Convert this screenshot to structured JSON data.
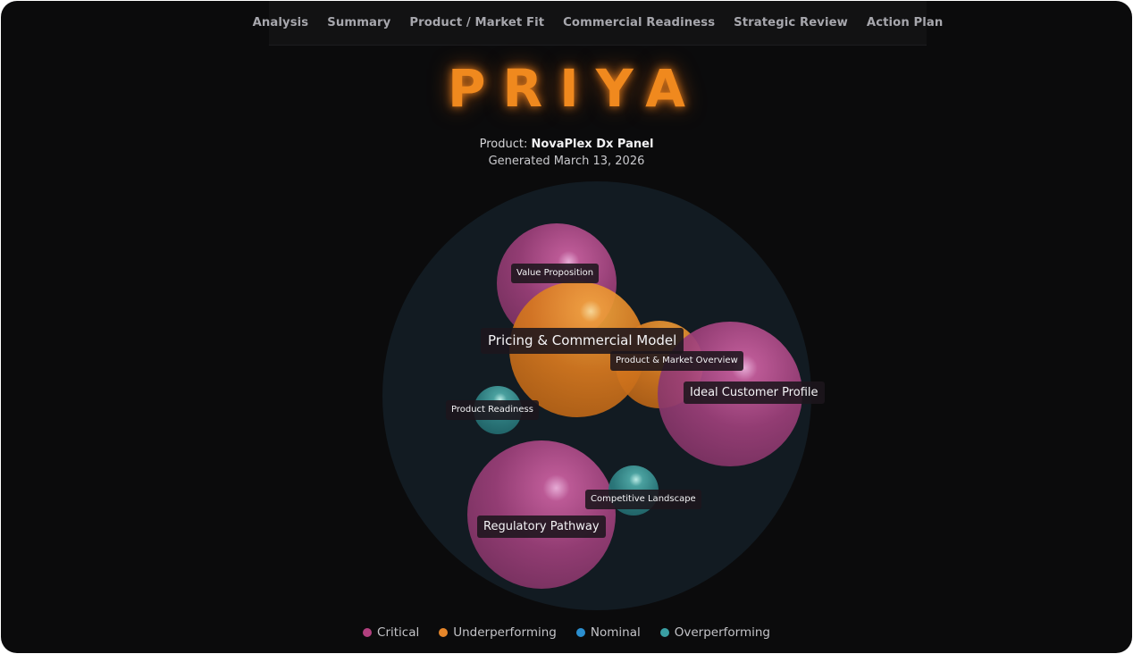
{
  "nav": {
    "items": [
      {
        "label": "Analysis"
      },
      {
        "label": "Summary"
      },
      {
        "label": "Product / Market Fit"
      },
      {
        "label": "Commercial Readiness"
      },
      {
        "label": "Strategic Review"
      },
      {
        "label": "Action Plan"
      }
    ]
  },
  "brand": {
    "logo": "PRIYA",
    "color": "#f0891e"
  },
  "header": {
    "product_prefix": "Product: ",
    "product_name": "NovaPlex Dx Panel",
    "generated": "Generated March 13, 2026"
  },
  "status_colors": {
    "critical": "#b2407f",
    "underperforming": "#e6862a",
    "nominal": "#2b8fd0",
    "overperforming": "#3a9fa3"
  },
  "bubbles": [
    {
      "label": "Value Proposition",
      "status": "critical"
    },
    {
      "label": "Pricing & Commercial Model",
      "status": "underperforming"
    },
    {
      "label": "Product & Market Overview",
      "status": "underperforming"
    },
    {
      "label": "Ideal Customer Profile",
      "status": "critical"
    },
    {
      "label": "Product Readiness",
      "status": "overperforming"
    },
    {
      "label": "Regulatory Pathway",
      "status": "critical"
    },
    {
      "label": "Competitive Landscape",
      "status": "overperforming"
    }
  ],
  "legend": [
    {
      "label": "Critical",
      "color": "#b2407f"
    },
    {
      "label": "Underperforming",
      "color": "#e6862a"
    },
    {
      "label": "Nominal",
      "color": "#2b8fd0"
    },
    {
      "label": "Overperforming",
      "color": "#3a9fa3"
    }
  ]
}
